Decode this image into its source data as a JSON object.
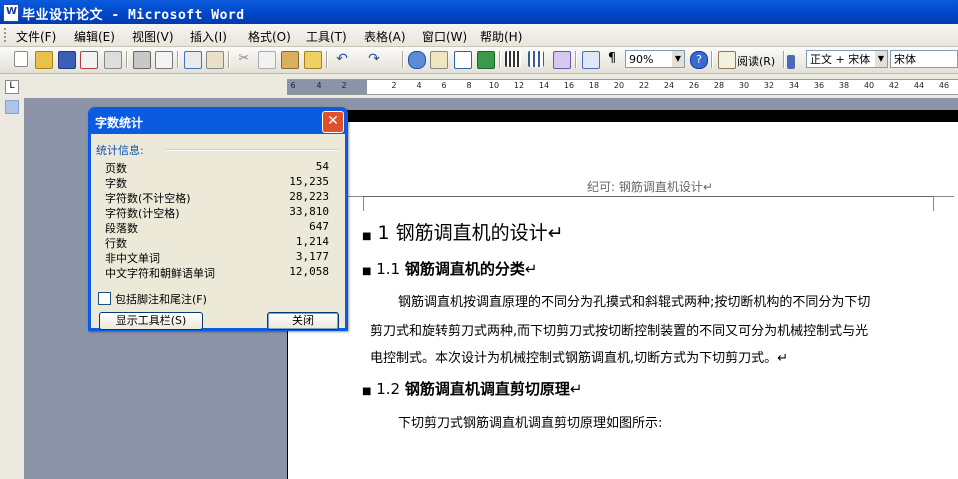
{
  "window": {
    "title": "毕业设计论文 - Microsoft Word"
  },
  "menu": {
    "items": [
      "文件(F)",
      "编辑(E)",
      "视图(V)",
      "插入(I)",
      "格式(O)",
      "工具(T)",
      "表格(A)",
      "窗口(W)",
      "帮助(H)"
    ]
  },
  "toolbar": {
    "zoom": "90%",
    "read_label": "阅读(R)",
    "style": "正文 + 宋体",
    "font": "宋体",
    "icons": [
      "new-icon",
      "open-icon",
      "save-icon",
      "permission-icon",
      "email-icon",
      "print-icon",
      "print-preview-icon",
      "spelling-icon",
      "research-icon",
      "cut-icon",
      "copy-icon",
      "paste-icon",
      "format-painter-icon",
      "undo-icon",
      "redo-icon",
      "hyperlink-icon",
      "tables-borders-icon",
      "insert-table-icon",
      "insert-excel-icon",
      "columns-icon",
      "drawing-icon",
      "document-map-icon",
      "show-hide-icon",
      "help-icon",
      "read-icon"
    ]
  },
  "ruler": {
    "ticks": [
      "6",
      "4",
      "2",
      "2",
      "4",
      "6",
      "8",
      "10",
      "12",
      "14",
      "16",
      "18",
      "20",
      "22",
      "24",
      "26",
      "28",
      "30",
      "32",
      "34",
      "36",
      "38",
      "40",
      "42",
      "44",
      "46"
    ]
  },
  "dialog": {
    "title": "字数统计",
    "section": "统计信息:",
    "stats": [
      {
        "label": "页数",
        "value": "54"
      },
      {
        "label": "字数",
        "value": "15,235"
      },
      {
        "label": "字符数(不计空格)",
        "value": "28,223"
      },
      {
        "label": "字符数(计空格)",
        "value": "33,810"
      },
      {
        "label": "段落数",
        "value": "647"
      },
      {
        "label": "行数",
        "value": "1,214"
      },
      {
        "label": "非中文单词",
        "value": "3,177"
      },
      {
        "label": "中文字符和朝鲜语单词",
        "value": "12,058"
      }
    ],
    "checkbox_label": "包括脚注和尾注(F)",
    "show_toolbar_button": "显示工具栏(S)",
    "close_button": "关闭"
  },
  "document": {
    "header": "纪可:  钢筋调直机设计↵",
    "h1": "1  钢筋调直机的设计↵",
    "h2a_num": "1.1 ",
    "h2a_text": "钢筋调直机的分类",
    "h2a_mark": "↵",
    "p1": "钢筋调直机按调直原理的不同分为孔摸式和斜辊式两种;按切断机构的不同分为下切",
    "p2": "剪刀式和旋转剪刀式两种,而下切剪刀式按切断控制装置的不同又可分为机械控制式与光",
    "p3": "电控制式。本次设计为机械控制式钢筋调直机,切断方式为下切剪刀式。↵",
    "h2b_num": "1.2 ",
    "h2b_text": "钢筋调直机调直剪切原理",
    "h2b_mark": "↵",
    "p4": "下切剪刀式钢筋调直机调直剪切原理如图所示:"
  }
}
